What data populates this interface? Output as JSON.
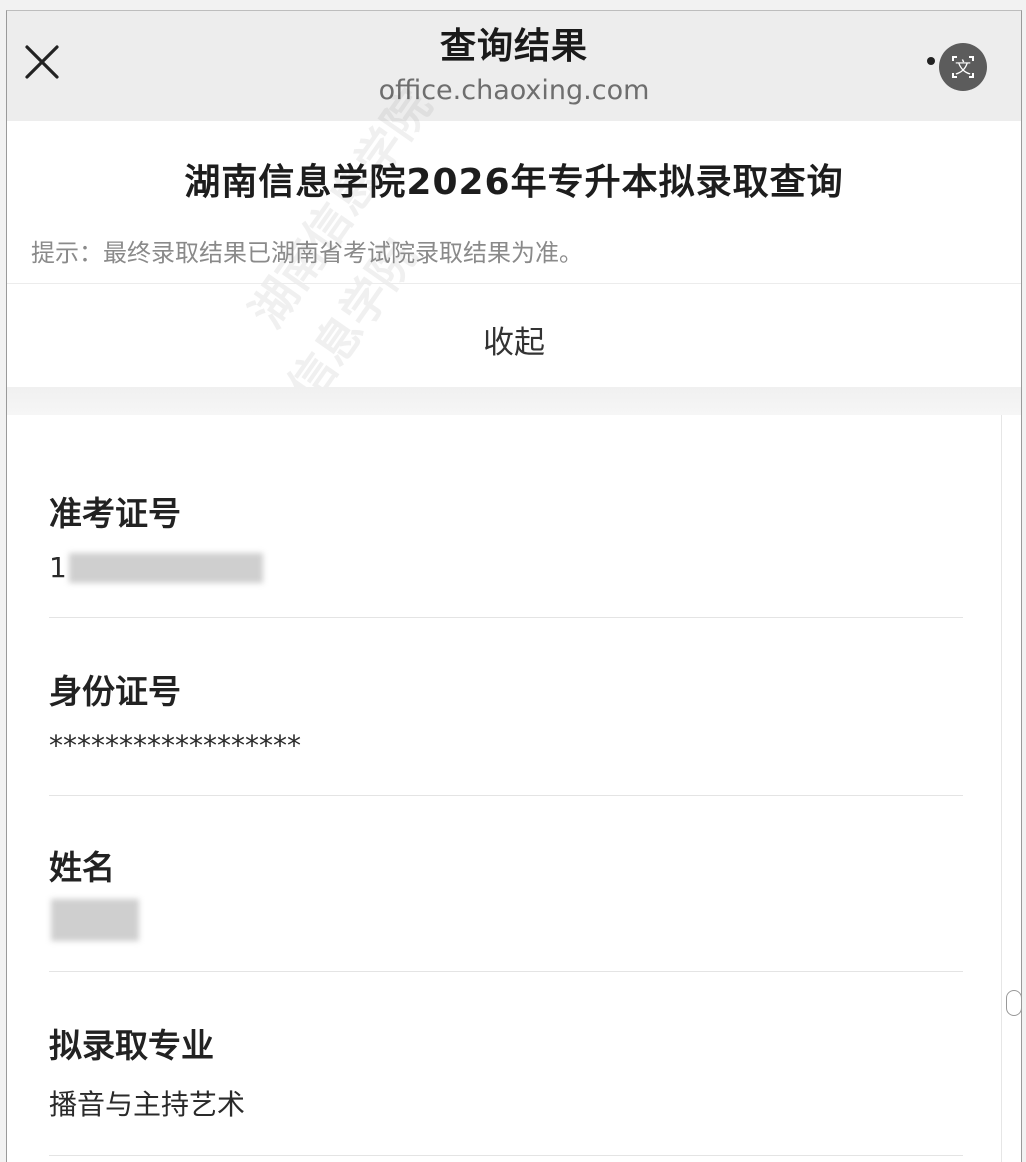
{
  "navbar": {
    "title": "查询结果",
    "url": "office.chaoxing.com",
    "close_icon": "close-icon",
    "translate_icon": "translate-icon"
  },
  "header": {
    "title": "湖南信息学院2026年专升本拟录取查询",
    "hint": "提示：最终录取结果已湖南省考试院录取结果为准。",
    "collapse_label": "收起"
  },
  "fields": [
    {
      "label": "准考证号",
      "value": "1"
    },
    {
      "label": "身份证号",
      "value": "******************"
    },
    {
      "label": "姓名",
      "value": ""
    },
    {
      "label": "拟录取专业",
      "value": "播音与主持艺术"
    }
  ],
  "watermark": "湖南信息学院"
}
